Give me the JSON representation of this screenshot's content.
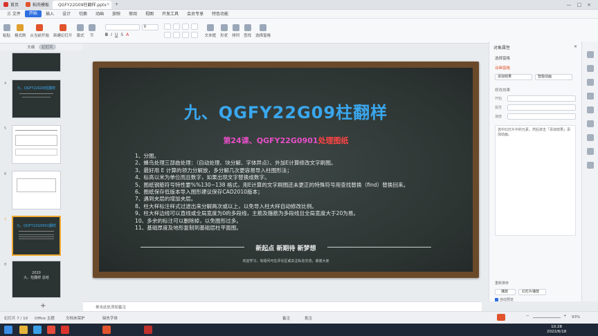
{
  "tabs": [
    {
      "label": "首页",
      "color": "#d9342b"
    },
    {
      "label": "稻壳模板",
      "color": "#e0532c"
    },
    {
      "label": "QGFY22G09柱翻样.pptx",
      "color": "#e0532c"
    }
  ],
  "menus": [
    "三 文件",
    "开始",
    "插入",
    "设计",
    "切换",
    "动画",
    "放映",
    "审阅",
    "视图",
    "开发工具",
    "会员专享",
    "特色功能"
  ],
  "menu_active": "开始",
  "ribbon": {
    "buttons": [
      "粘贴",
      "格式刷",
      "从当前开始",
      "新建幻灯片",
      "版式",
      "节",
      "文本框",
      "形状",
      "排列",
      "查找",
      "选择窗格"
    ],
    "font_size": "0"
  },
  "slide_panel": {
    "header_left": "大纲",
    "header_right": "幻灯片",
    "numbers": [
      "4",
      "5",
      "6",
      "7",
      "8"
    ]
  },
  "slide": {
    "title": "九、QGFY22G09柱翻样",
    "subtitle_a": "第24课、QGFY22G0901",
    "subtitle_b": "处理图纸",
    "lines": [
      "1、分图。",
      "2、蜂鸟处理三部曲处理：（自动处理、块分解、字体异点）、外加E计算修改文字刷图。",
      "3、最好用 E 计算的领力分解放，多分解几次更容易导入柱图形法；",
      "4、标高以米为单位而且数字，如果出现文字替换成数字。",
      "5、图纸钢筋符号特性要%%130~138 格式，用E计算的文字刷图还未更正的特殊符号用查找替换（find）替换回来。",
      "6、图纸保存低版本导入图形建议保存CAD2010版本；",
      "7、遇到夹层的增加夹层。",
      "8、柱大样标注样式过滤出来分解两次或以上，以免导入柱大样自动修改比例。",
      "9、柱大样边线可以直线或全局宽度为0的多段线，主筋及箍筋为多段线且全局宽度大于20为易。",
      "10、多余的标注可以删除掉，以免图形过多。",
      "11、基础厚度及地形复制到基础层柱平面图。"
    ],
    "footer": "新起点  新期待  新梦想",
    "note": "欢迎学习，有疑问可在评论区或关注私信交流，谢谢大家"
  },
  "right_panel": {
    "title": "对象属性",
    "items": [
      "选择窗格",
      "动画窗格",
      "添加效果",
      "智能动画",
      "修改效果",
      "开始",
      "属性",
      "速度"
    ],
    "hint": "选中幻灯片中的元素，然后单击「添加效果」添加动画。",
    "bottom": [
      "重新排序",
      "播放",
      "幻灯片播放",
      "自动预览"
    ]
  },
  "notes_placeholder": "单击此处添加备注",
  "status": {
    "slide_info": "幻灯片 7 / 10",
    "theme": "Office 主题",
    "doc_check": "文档未保护",
    "font_missing": "缺失字体",
    "notes": "备注",
    "comments": "批注",
    "zoom": "93%"
  },
  "clock": {
    "time": "10:28",
    "date": "2022/6/18"
  },
  "colors": {
    "accent": "#2f6fe0",
    "title_blue": "#3aa7ee",
    "subtitle_pink": "#e84fc9",
    "subtitle_red": "#ff4444",
    "frame_wood": "#6b4a2b",
    "selection": "#f0a830"
  }
}
